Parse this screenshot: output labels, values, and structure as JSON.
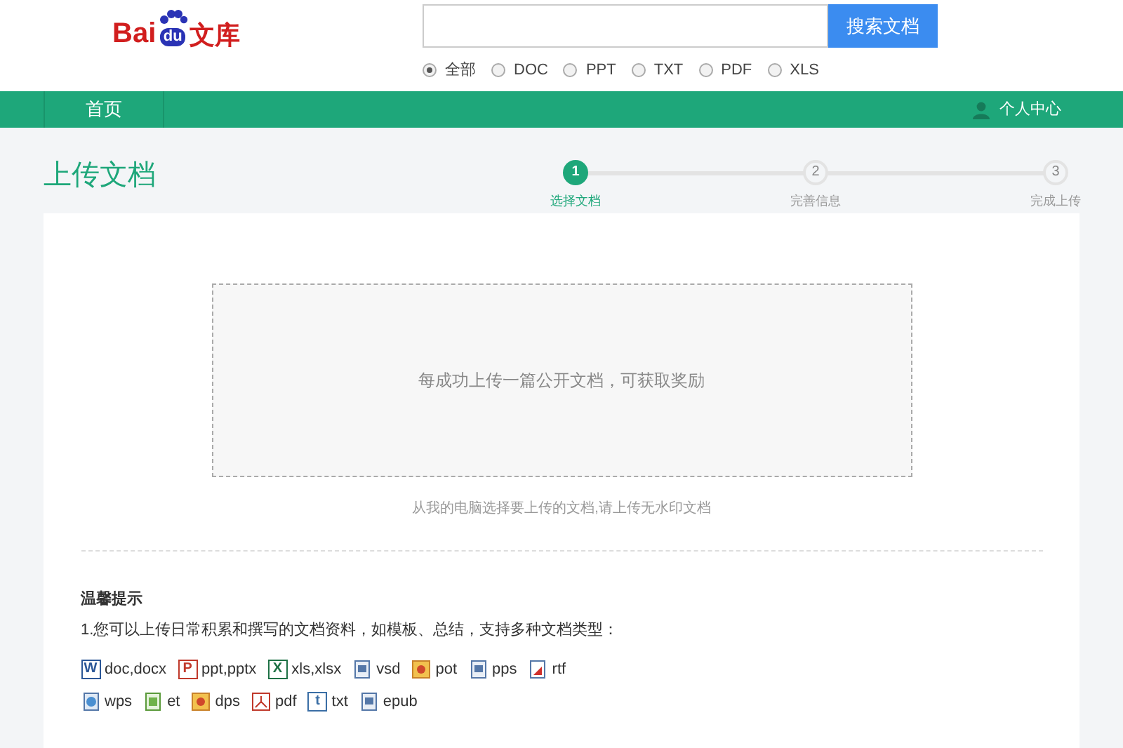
{
  "logo": {
    "left": "Bai",
    "paw": "du",
    "right": "文库"
  },
  "search": {
    "button": "搜索文档"
  },
  "filters": [
    {
      "label": "全部",
      "selected": true
    },
    {
      "label": "DOC",
      "selected": false
    },
    {
      "label": "PPT",
      "selected": false
    },
    {
      "label": "TXT",
      "selected": false
    },
    {
      "label": "PDF",
      "selected": false
    },
    {
      "label": "XLS",
      "selected": false
    }
  ],
  "nav": {
    "items": [
      {
        "label": "首页"
      }
    ],
    "user": "个人中心"
  },
  "page_title": "上传文档",
  "steps": [
    {
      "number": "1",
      "label": "选择文档",
      "selected": true
    },
    {
      "number": "2",
      "label": "完善信息",
      "selected": false
    },
    {
      "number": "3",
      "label": "完成上传",
      "selected": false
    }
  ],
  "dropzone": {
    "text": "每成功上传一篇公开文档，可获取奖励"
  },
  "upload_hint": "从我的电脑选择要上传的文档,请上传无水印文档",
  "tips": {
    "title": "温馨提示",
    "line_1": "1.您可以上传日常积累和撰写的文档资料，如模板、总结，支持多种文档类型：",
    "file_types": [
      {
        "kind": "word",
        "icon_letter": "W",
        "label": "doc,docx"
      },
      {
        "kind": "ppt",
        "icon_letter": "P",
        "label": "ppt,pptx"
      },
      {
        "kind": "excel",
        "icon_letter": "X",
        "label": "xls,xlsx"
      },
      {
        "kind": "doc",
        "label": "vsd"
      },
      {
        "kind": "image",
        "label": "pot"
      },
      {
        "kind": "doc",
        "label": "pps"
      },
      {
        "kind": "rtf",
        "label": "rtf"
      },
      {
        "kind": "globe",
        "label": "wps"
      },
      {
        "kind": "sheet",
        "label": "et"
      },
      {
        "kind": "image",
        "label": "dps"
      },
      {
        "kind": "pdf",
        "label": "pdf"
      },
      {
        "kind": "txt",
        "icon_letter": "t",
        "label": "txt"
      },
      {
        "kind": "doc",
        "label": "epub"
      }
    ]
  }
}
